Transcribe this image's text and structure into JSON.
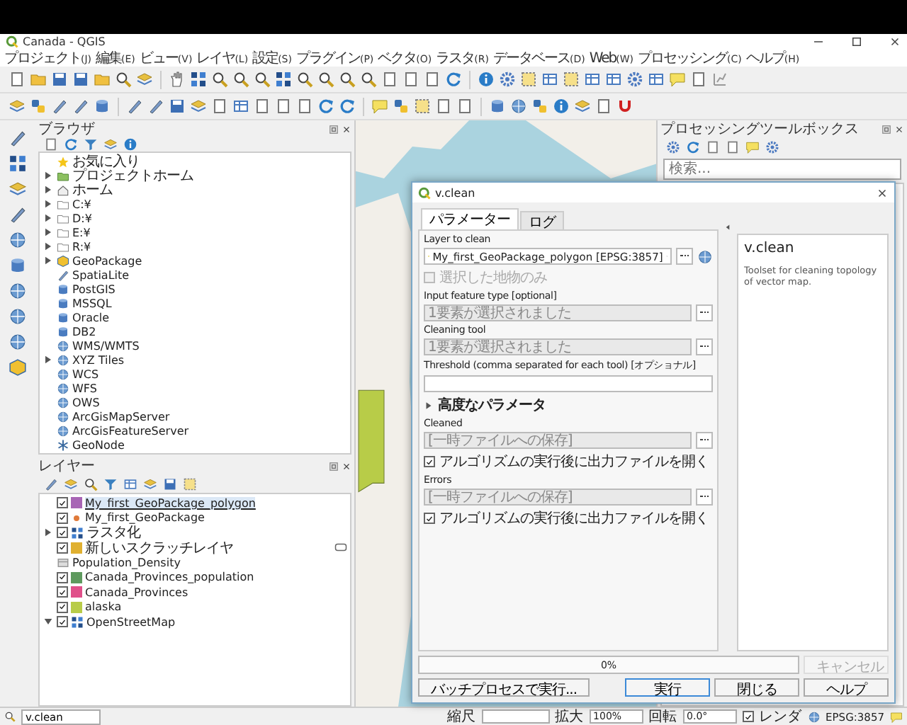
{
  "window": {
    "title": "Canada - QGIS"
  },
  "menu": [
    {
      "label": "プロジェクト",
      "accel": "(J)"
    },
    {
      "label": "編集",
      "accel": "(E)"
    },
    {
      "label": "ビュー",
      "accel": "(V)"
    },
    {
      "label": "レイヤ",
      "accel": "(L)"
    },
    {
      "label": "設定",
      "accel": "(S)"
    },
    {
      "label": "プラグイン",
      "accel": "(P)"
    },
    {
      "label": "ベクタ",
      "accel": "(O)"
    },
    {
      "label": "ラスタ",
      "accel": "(R)"
    },
    {
      "label": "データベース",
      "accel": "(D)"
    },
    {
      "label": "Web",
      "accel": "(W)"
    },
    {
      "label": "プロセッシング",
      "accel": "(C)"
    },
    {
      "label": "ヘルプ",
      "accel": "(H)"
    }
  ],
  "browser": {
    "title": "ブラウザ",
    "items": [
      {
        "label": "お気に入り",
        "kind": "favorites",
        "expandable": false
      },
      {
        "label": "プロジェクトホーム",
        "kind": "project",
        "expandable": true
      },
      {
        "label": "ホーム",
        "kind": "home",
        "expandable": true
      },
      {
        "label": "C:¥",
        "kind": "drive",
        "expandable": true
      },
      {
        "label": "D:¥",
        "kind": "drive",
        "expandable": true
      },
      {
        "label": "E:¥",
        "kind": "drive",
        "expandable": true
      },
      {
        "label": "R:¥",
        "kind": "drive",
        "expandable": true
      },
      {
        "label": "GeoPackage",
        "kind": "geopackage",
        "expandable": true
      },
      {
        "label": "SpatiaLite",
        "kind": "spatialite",
        "expandable": false
      },
      {
        "label": "PostGIS",
        "kind": "database",
        "expandable": false
      },
      {
        "label": "MSSQL",
        "kind": "database",
        "expandable": false
      },
      {
        "label": "Oracle",
        "kind": "database",
        "expandable": false
      },
      {
        "label": "DB2",
        "kind": "database",
        "expandable": false
      },
      {
        "label": "WMS/WMTS",
        "kind": "service",
        "expandable": false
      },
      {
        "label": "XYZ Tiles",
        "kind": "service",
        "expandable": true
      },
      {
        "label": "WCS",
        "kind": "service",
        "expandable": false
      },
      {
        "label": "WFS",
        "kind": "service",
        "expandable": false
      },
      {
        "label": "OWS",
        "kind": "service",
        "expandable": false
      },
      {
        "label": "ArcGisMapServer",
        "kind": "service",
        "expandable": false
      },
      {
        "label": "ArcGisFeatureServer",
        "kind": "service",
        "expandable": false
      },
      {
        "label": "GeoNode",
        "kind": "geonode",
        "expandable": false
      }
    ]
  },
  "layers": {
    "title": "レイヤー",
    "items": [
      {
        "label": "My_first_GeoPackage_polygon",
        "kind": "polygon",
        "color": "#a865b5",
        "checked": true,
        "selected": true,
        "expandable": false,
        "indicator": false
      },
      {
        "label": "My_first_GeoPackage",
        "kind": "point",
        "color": "#e07a3a",
        "checked": true,
        "selected": false,
        "expandable": false,
        "indicator": false
      },
      {
        "label": "ラスタ化",
        "kind": "raster",
        "checked": true,
        "selected": false,
        "expandable": true,
        "expanded": false,
        "indicator": false
      },
      {
        "label": "新しいスクラッチレイヤ",
        "kind": "polygon",
        "color": "#e0b030",
        "checked": true,
        "selected": false,
        "expandable": false,
        "indicator": true
      },
      {
        "label": "Population_Density",
        "kind": "table",
        "selected": false,
        "expandable": false,
        "indicator": false
      },
      {
        "label": "Canada_Provinces_population",
        "kind": "polygon",
        "color": "#5e9a5e",
        "checked": true,
        "selected": false,
        "expandable": false,
        "indicator": false
      },
      {
        "label": "Canada_Provinces",
        "kind": "polygon",
        "color": "#e0508a",
        "checked": true,
        "selected": false,
        "expandable": false,
        "indicator": false
      },
      {
        "label": "alaska",
        "kind": "polygon",
        "color": "#b8cc48",
        "checked": true,
        "selected": false,
        "expandable": false,
        "indicator": false
      },
      {
        "label": "OpenStreetMap",
        "kind": "raster",
        "checked": true,
        "selected": false,
        "expandable": true,
        "expanded": true,
        "indicator": false
      }
    ]
  },
  "toolbox": {
    "title": "プロセッシングツールボックス",
    "search": {
      "placeholder": "検索..."
    }
  },
  "dialog": {
    "title": "v.clean",
    "tabs": [
      {
        "label": "パラメーター",
        "selected": true
      },
      {
        "label": "ログ",
        "selected": false
      }
    ],
    "params": [
      {
        "kind": "label",
        "text": "Layer to clean"
      },
      {
        "kind": "combo",
        "text": "My_first_GeoPackage_polygon [EPSG:3857]"
      },
      {
        "kind": "checkbox",
        "text": "選択した地物のみ",
        "checked": false,
        "disabled": true
      },
      {
        "kind": "label",
        "text": "Input feature type [optional]"
      },
      {
        "kind": "select",
        "text": "1要素が選択されました"
      },
      {
        "kind": "label",
        "text": "Cleaning tool"
      },
      {
        "kind": "select",
        "text": "1要素が選択されました"
      },
      {
        "kind": "label",
        "text": "Threshold (comma separated for each tool) [オプショナル]"
      },
      {
        "kind": "text"
      },
      {
        "kind": "section",
        "text": "高度なパラメータ",
        "expanded": false
      },
      {
        "kind": "label",
        "text": "Cleaned"
      },
      {
        "kind": "select",
        "text": "[一時ファイルへの保存]"
      },
      {
        "kind": "checkbox",
        "text": "アルゴリズムの実行後に出力ファイルを開く",
        "checked": true,
        "disabled": false
      },
      {
        "kind": "label",
        "text": "Errors"
      },
      {
        "kind": "select",
        "text": "[一時ファイルへの保存]"
      },
      {
        "kind": "checkbox",
        "text": "アルゴリズムの実行後に出力ファイルを開く",
        "checked": true,
        "disabled": false
      }
    ],
    "help": {
      "heading": "v.clean",
      "text": "Toolset for cleaning topology of vector map."
    },
    "progress": {
      "text": "0%",
      "level": 0
    },
    "cancel": {
      "label": "キャンセル",
      "disabled": true
    },
    "batch": {
      "label": "バッチプロセスで実行..."
    },
    "buttons": [
      {
        "label": "実行",
        "default": true
      },
      {
        "label": "閉じる",
        "default": false
      },
      {
        "label": "ヘルプ",
        "default": false
      }
    ]
  },
  "status_bar": {
    "search": {
      "value": "v.clean"
    },
    "items": [
      {
        "kind": "label",
        "text": "縮尺"
      },
      {
        "kind": "empty-field"
      },
      {
        "kind": "label",
        "text": "拡大"
      },
      {
        "kind": "field",
        "text": "100%"
      },
      {
        "kind": "label",
        "text": "回転"
      },
      {
        "kind": "field",
        "text": "0.0°"
      },
      {
        "kind": "check",
        "text": "レンダ",
        "checked": true
      },
      {
        "kind": "crs",
        "text": "EPSG:3857"
      }
    ]
  }
}
